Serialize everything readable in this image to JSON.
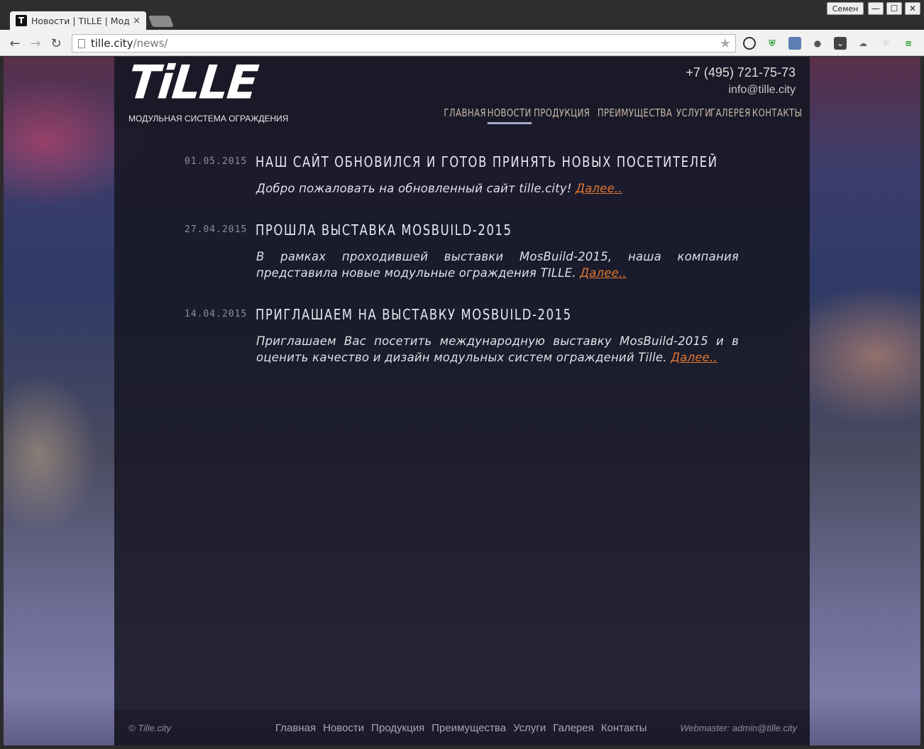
{
  "browser": {
    "tab_title": "Новости | TILLE | Модульная система ограждения",
    "tab_favicon": "T",
    "tab_close": "×",
    "user_name": "Семен",
    "url_host": "tille.city",
    "url_path": "/news/",
    "win_minimize": "—",
    "win_maximize": "☐",
    "win_close": "✕"
  },
  "header": {
    "logo": "TiLLE",
    "tagline": "МОДУЛЬНАЯ СИСТЕМА ОГРАЖДЕНИЯ",
    "phone": "+7 (495) 721-75-73",
    "email": "info@tille.city"
  },
  "nav": {
    "items": [
      {
        "label": "ГЛАВНАЯ"
      },
      {
        "label": "НОВОСТИ"
      },
      {
        "label": "ПРОДУКЦИЯ"
      },
      {
        "label": "ПРЕИМУЩЕСТВА"
      },
      {
        "label": "УСЛУГИ"
      },
      {
        "label": "ГАЛЕРЕЯ"
      },
      {
        "label": "КОНТАКТЫ"
      }
    ],
    "active": "НОВОСТИ"
  },
  "news": [
    {
      "date": "01.05.2015",
      "title": "НАШ САЙТ ОБНОВИЛСЯ И ГОТОВ ПРИНЯТЬ НОВЫХ ПОСЕТИТЕЛЕЙ",
      "text": "Добро пожаловать на обновленный сайт tille.city!",
      "more": "Далее.."
    },
    {
      "date": "27.04.2015",
      "title": "ПРОШЛА ВЫСТАВКА MOSBUILD-2015",
      "text": "В рамках проходившей выставки MosBuild-2015, наша компания представила новые модульные ограждения TILLE.",
      "more": "Далее.."
    },
    {
      "date": "14.04.2015",
      "title": "ПРИГЛАШАЕМ НА ВЫСТАВКУ MOSBUILD-2015",
      "text": "Приглашаем Вас посетить международную выставку MosBuild-2015 и в оценить качество и дизайн модульных систем ограждений Tille.",
      "more": "Далее.."
    }
  ],
  "footer": {
    "copyright": "© Tille.city",
    "links": [
      "Главная",
      "Новости",
      "Продукция",
      "Преимущества",
      "Услуги",
      "Галерея",
      "Контакты"
    ],
    "webmaster": "Webmaster: admin@tille.city"
  },
  "colors": {
    "link_accent": "#e0772e",
    "nav_text": "#c9b9a9"
  }
}
